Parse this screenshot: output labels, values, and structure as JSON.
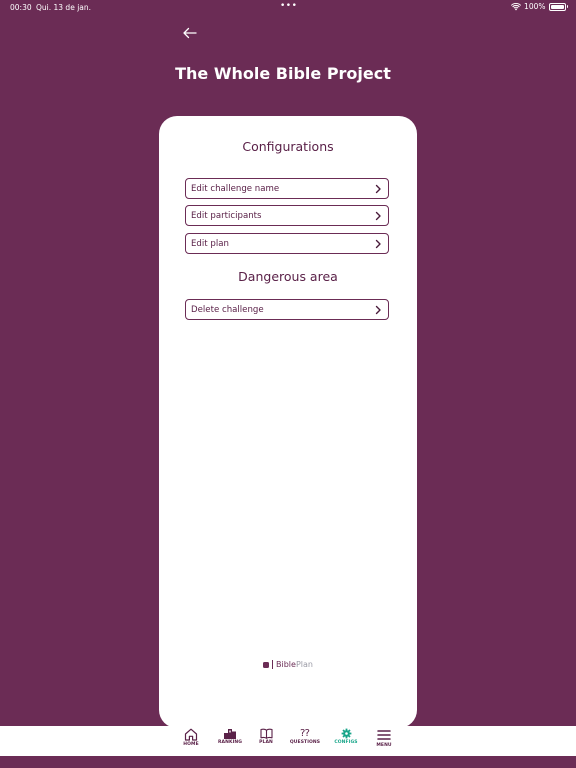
{
  "status_bar": {
    "time": "00:30",
    "date": "Qui. 13 de jan.",
    "dots": "•••",
    "battery": "100%"
  },
  "header": {
    "back_icon": "arrow-left-icon",
    "title": "The Whole Bible Project"
  },
  "configurations": {
    "title": "Configurations",
    "options": [
      {
        "label": "Edit challenge name",
        "icon": "chevron-right-icon"
      },
      {
        "label": "Edit participants",
        "icon": "chevron-right-icon"
      },
      {
        "label": "Edit plan",
        "icon": "chevron-right-icon"
      }
    ]
  },
  "danger": {
    "title": "Dangerous area",
    "options": [
      {
        "label": "Delete challenge",
        "icon": "chevron-right-icon"
      }
    ]
  },
  "brand": {
    "part1": "Bible",
    "part2": "Plan"
  },
  "nav": {
    "items": [
      {
        "label": "HOME",
        "icon": "home-icon"
      },
      {
        "label": "RANKING",
        "icon": "podium-icon"
      },
      {
        "label": "PLAN",
        "icon": "book-icon"
      },
      {
        "label": "QUESTIONS",
        "glyph": "⁇",
        "icon": "questions-icon"
      },
      {
        "label": "CONFIGS",
        "icon": "gear-icon",
        "active": true
      },
      {
        "label": "MENU",
        "icon": "hamburger-menu-icon"
      }
    ]
  },
  "colors": {
    "background": "#6b2c55",
    "card": "#ffffff",
    "text_primary": "#5a2148",
    "active": "#17a589",
    "brand_secondary": "#9a9aa5"
  }
}
